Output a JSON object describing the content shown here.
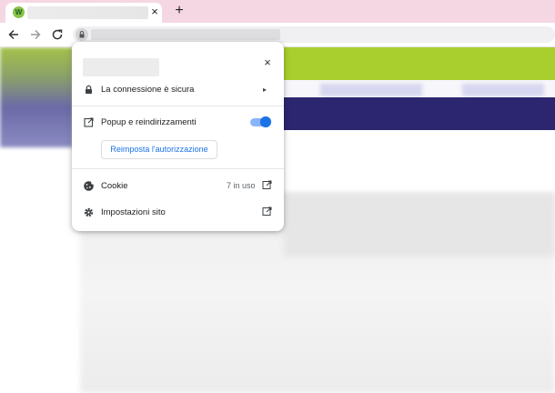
{
  "browser": {
    "tab": {
      "favicon_letter": "W",
      "favicon_color": "#8bc34a",
      "close_glyph": "×"
    },
    "new_tab_glyph": "+",
    "nav": {
      "back_icon": "arrow-left-icon",
      "forward_icon": "arrow-right-icon",
      "reload_icon": "reload-icon"
    }
  },
  "page": {
    "colors": {
      "green_bar": "#a9cf2e",
      "navy_bar": "#2c2670"
    }
  },
  "popup": {
    "close_glyph": "×",
    "connection": {
      "label": "La connessione è sicura",
      "icon": "lock-icon",
      "chevron": "▸"
    },
    "popups": {
      "label": "Popup e reindirizzamenti",
      "icon": "external-link-icon",
      "toggle_on": true
    },
    "reset_button": "Reimposta l'autorizzazione",
    "cookie": {
      "label": "Cookie",
      "value": "7 in uso",
      "icon": "cookie-icon"
    },
    "site_settings": {
      "label": "Impostazioni sito",
      "icon": "gear-icon"
    }
  }
}
